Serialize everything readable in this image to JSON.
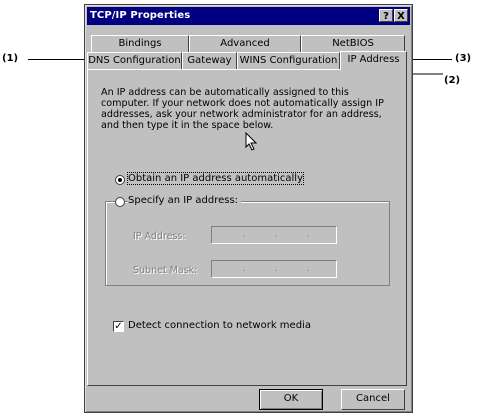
{
  "window": {
    "title": "TCP/IP Properties",
    "help_label": "?",
    "close_label": "X"
  },
  "tabs": {
    "row1": [
      "Bindings",
      "Advanced",
      "NetBIOS"
    ],
    "row2": [
      "DNS Configuration",
      "Gateway",
      "WINS Configuration",
      "IP Address"
    ],
    "active": "IP Address"
  },
  "panel": {
    "info_text": "An IP address can be automatically assigned to this computer. If your network does not automatically assign IP addresses, ask your network administrator for an address, and then type it in the space below.",
    "radio_obtain": "Obtain an IP address automatically",
    "radio_specify": "Specify an IP address:",
    "ip_label": "IP Address:",
    "subnet_label": "Subnet Mask:",
    "ip_dot": ".",
    "detect_label": "Detect connection to network media",
    "detect_mark": "✓"
  },
  "buttons": {
    "ok": "OK",
    "cancel": "Cancel"
  },
  "callouts": {
    "c1": "(1)",
    "c2": "(2)",
    "c3": "(3)"
  }
}
